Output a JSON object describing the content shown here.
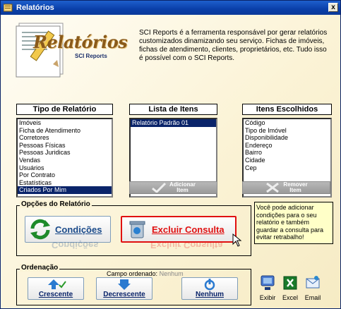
{
  "window": {
    "title": "Relatórios",
    "close_label": "x"
  },
  "header": {
    "logo_text": "Relatórios",
    "logo_sub": "SCI Reports",
    "intro": "SCI Reports é a ferramenta responsável por gerar relatórios customizados dinamizando seu serviço. Fichas de imóveis, fichas de atendimento, clientes, proprietários, etc. Tudo isso é possível com o SCI Reports."
  },
  "columns": {
    "tipo_title": "Tipo de Relatório",
    "lista_title": "Lista de Itens",
    "escolhidos_title": "Itens Escolhidos"
  },
  "tipo_items": [
    "Imóveis",
    "Ficha de Atendimento",
    "Corretores",
    "Pessoas Físicas",
    "Pessoas Juridicas",
    "Vendas",
    "Usuários",
    "Por Contrato",
    "Estatísticas",
    "Criados Por Mim"
  ],
  "tipo_selected": "Criados Por Mim",
  "lista_items": [
    "Relatório Padrão 01"
  ],
  "escolhidos_items": [
    "Código",
    "Tipo de Imóvel",
    "Disponibilidade",
    "Endereço",
    "Bairro",
    "Cidade",
    "Cep"
  ],
  "buttons": {
    "adicionar_line1": "Adicionar",
    "adicionar_line2": "Item",
    "remover_line1": "Remover",
    "remover_line2": "Item",
    "condicoes": "Condições",
    "excluir": "Excluir Consulta"
  },
  "opcoes": {
    "title": "Opções do Relatório"
  },
  "info": "Você pode adicionar condições para o seu relatório e também guardar a consulta para evitar retrabalho!",
  "ordenacao": {
    "title": "Ordenação",
    "campo_label": "Campo ordenado:",
    "campo_value": "Nenhum",
    "crescente": "Crescente",
    "decrescente": "Decrescente",
    "nenhum": "Nenhum"
  },
  "export": {
    "exibir": "Exibir",
    "excel": "Excel",
    "email": "Email"
  },
  "colors": {
    "title_blue": "#0a3fa8",
    "selection": "#0a246a",
    "highlight_red": "#e01010",
    "info_bg": "#ffffc8"
  }
}
